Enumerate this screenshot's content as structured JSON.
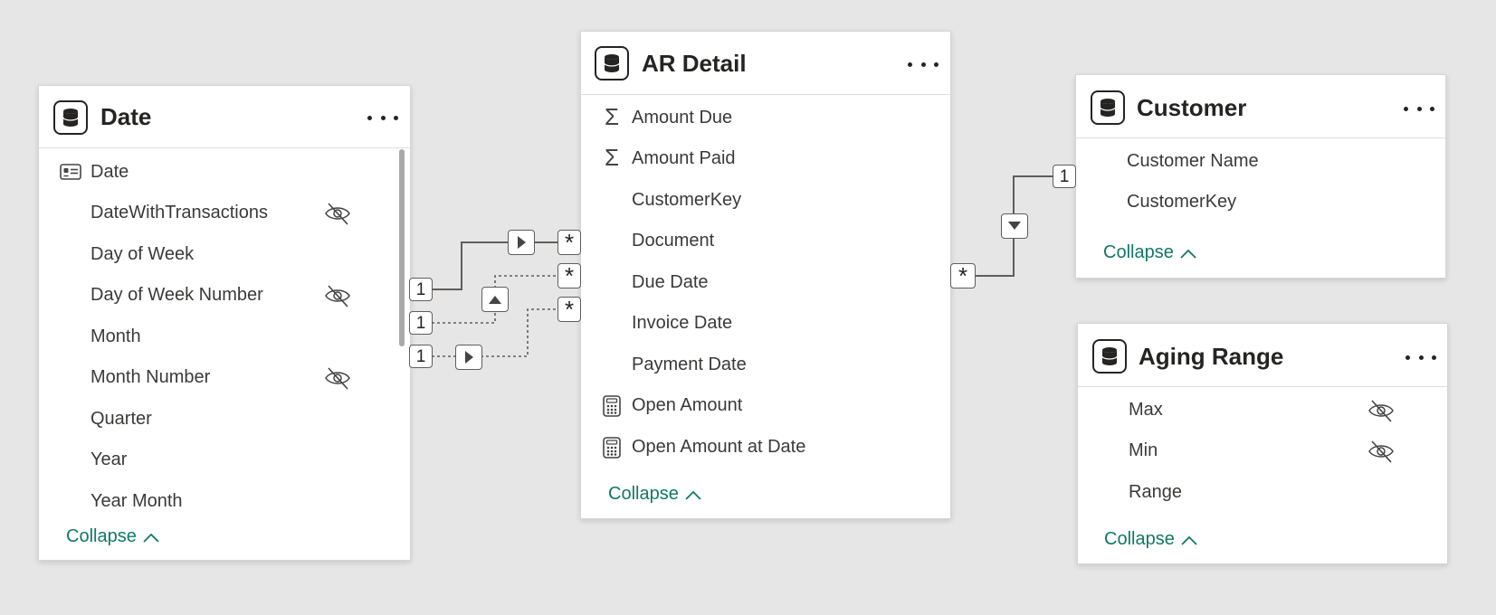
{
  "tables": {
    "date": {
      "title": "Date",
      "fields": [
        {
          "label": "Date",
          "icon": "calendar-icon",
          "hidden": false
        },
        {
          "label": "DateWithTransactions",
          "hidden": true
        },
        {
          "label": "Day of Week",
          "hidden": false
        },
        {
          "label": "Day of Week Number",
          "hidden": true
        },
        {
          "label": "Month",
          "hidden": false
        },
        {
          "label": "Month Number",
          "hidden": true
        },
        {
          "label": "Quarter",
          "hidden": false
        },
        {
          "label": "Year",
          "hidden": false
        },
        {
          "label": "Year Month",
          "hidden": false
        }
      ],
      "collapse_label": "Collapse"
    },
    "ar_detail": {
      "title": "AR Detail",
      "fields": [
        {
          "label": "Amount Due",
          "icon": "sigma-icon"
        },
        {
          "label": "Amount Paid",
          "icon": "sigma-icon"
        },
        {
          "label": "CustomerKey"
        },
        {
          "label": "Document"
        },
        {
          "label": "Due Date"
        },
        {
          "label": "Invoice Date"
        },
        {
          "label": "Payment Date"
        },
        {
          "label": "Open Amount",
          "icon": "calculator-icon"
        },
        {
          "label": "Open Amount at Date",
          "icon": "calculator-icon"
        }
      ],
      "collapse_label": "Collapse"
    },
    "customer": {
      "title": "Customer",
      "fields": [
        {
          "label": "Customer Name"
        },
        {
          "label": "CustomerKey"
        }
      ],
      "collapse_label": "Collapse"
    },
    "aging_range": {
      "title": "Aging Range",
      "fields": [
        {
          "label": "Max",
          "hidden": true
        },
        {
          "label": "Min",
          "hidden": true
        },
        {
          "label": "Range",
          "hidden": false
        }
      ],
      "collapse_label": "Collapse"
    }
  },
  "relationships": {
    "one": "1",
    "many": "*"
  },
  "colors": {
    "canvas": "#e6e6e6",
    "collapse_link": "#117865",
    "line": "#605e5c"
  }
}
